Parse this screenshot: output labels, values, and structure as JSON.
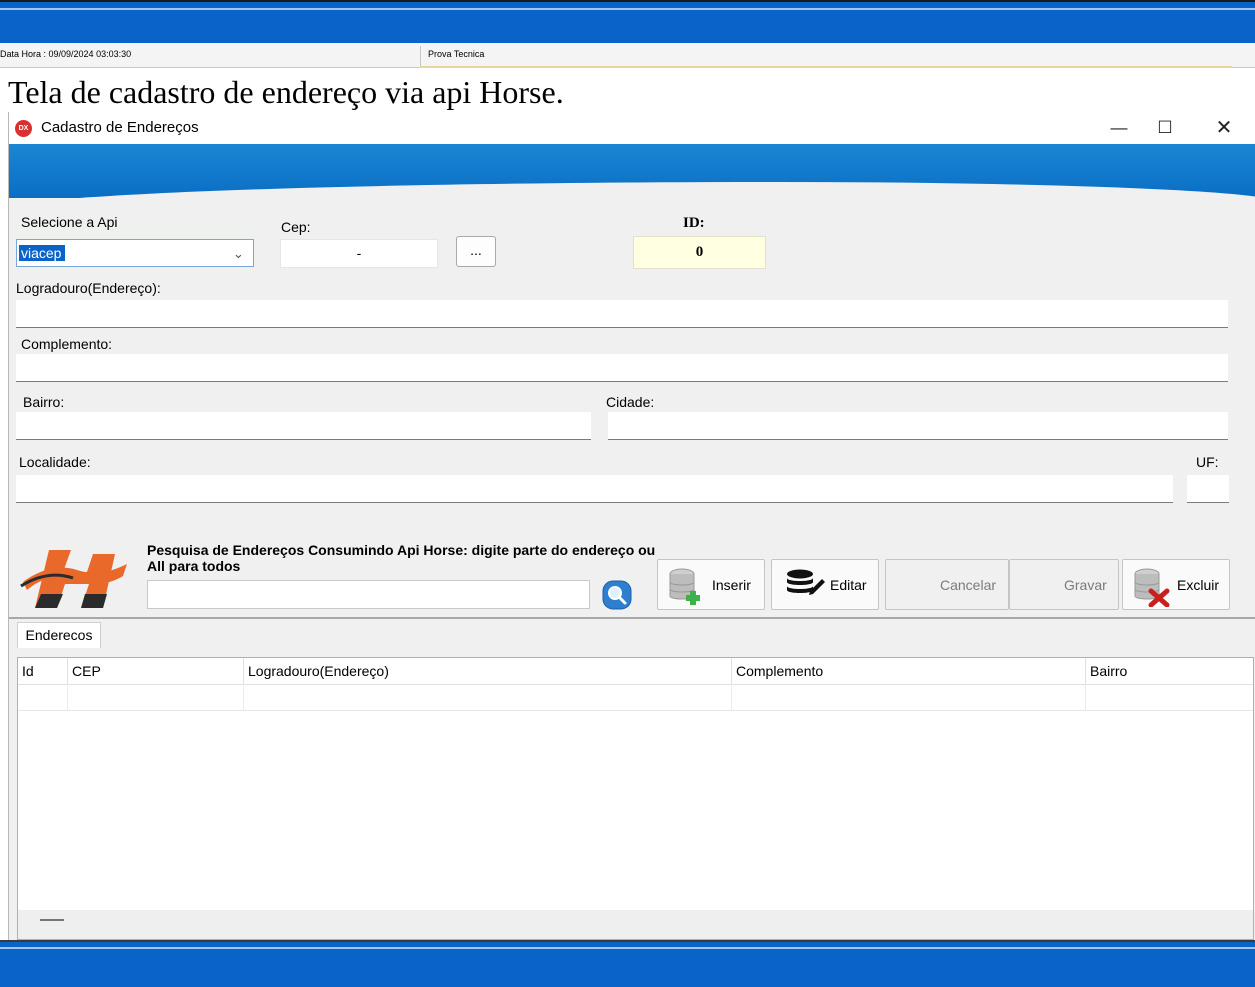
{
  "status_bar": {
    "datetime": "Data Hora : 09/09/2024 03:03:30",
    "app_name": "Prova Tecnica"
  },
  "caption": "Tela de cadastro de endereço via api Horse.",
  "window": {
    "icon_text": "DX",
    "title": "Cadastro de Endereços",
    "minimize_glyph": "—",
    "maximize_glyph": "☐",
    "close_glyph": "✕"
  },
  "form": {
    "api_label": "Selecione a Api",
    "api_selected": "viacep",
    "cep_label": "Cep:",
    "cep_value": "-",
    "cep_button": "...",
    "id_label": "ID:",
    "id_value": "0",
    "logradouro_label": "Logradouro(Endereço):",
    "logradouro_value": "",
    "complemento_label": "Complemento:",
    "complemento_value": "",
    "bairro_label": "Bairro:",
    "bairro_value": "",
    "cidade_label": "Cidade:",
    "cidade_value": "",
    "localidade_label": "Localidade:",
    "localidade_value": "",
    "uf_label": "UF:",
    "uf_value": ""
  },
  "search": {
    "caption": "Pesquisa de Endereços Consumindo Api Horse: digite parte do endereço ou All para todos",
    "value": ""
  },
  "toolbar": {
    "inserir": "Inserir",
    "editar": "Editar",
    "cancelar": "Cancelar",
    "gravar": "Gravar",
    "excluir": "Excluir"
  },
  "tabs": [
    "Enderecos"
  ],
  "grid": {
    "columns": [
      "Id",
      "CEP",
      "Logradouro(Endereço)",
      "Complemento",
      "Bairro"
    ],
    "rows": []
  },
  "icons": {
    "app": "app-icon",
    "search": "search-icon",
    "inserir": "database-add-icon",
    "editar": "database-edit-icon",
    "excluir": "database-delete-icon",
    "logo": "horse-logo-icon"
  },
  "colors": {
    "banner_blue": "#0a63c9",
    "header_blue": "#1b86d4",
    "id_background": "#ffffe1",
    "selection_blue": "#0a63c9"
  }
}
